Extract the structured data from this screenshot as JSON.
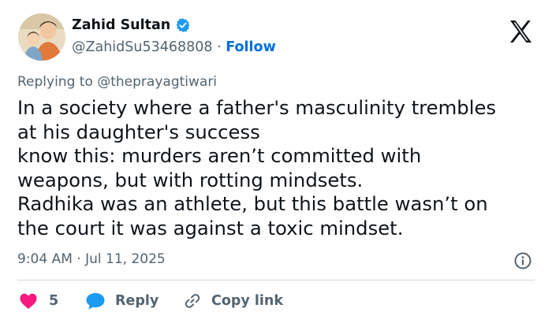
{
  "author": {
    "name": "Zahid Sultan",
    "handle": "@ZahidSu53468808",
    "separator": "·",
    "follow_label": "Follow",
    "verified": true
  },
  "brand": {
    "logo": "x-logo-icon",
    "verified_color": "#1d9bf0",
    "like_color": "#f91880",
    "reply_color": "#1d9bf0",
    "link_color": "#006fd6"
  },
  "tweet": {
    "replying_to": "Replying to @theprayagtiwari",
    "lines": [
      "In a society where a father's masculinity trembles",
      "at his daughter's success",
      "know this: murders aren’t committed with",
      "weapons, but with rotting mindsets.",
      "Radhika was an athlete, but this battle wasn’t on",
      "the court  it was against a toxic mindset."
    ],
    "timestamp": "9:04 AM · Jul 11, 2025"
  },
  "actions": {
    "like_count": "5",
    "reply_label": "Reply",
    "copy_link_label": "Copy link"
  }
}
